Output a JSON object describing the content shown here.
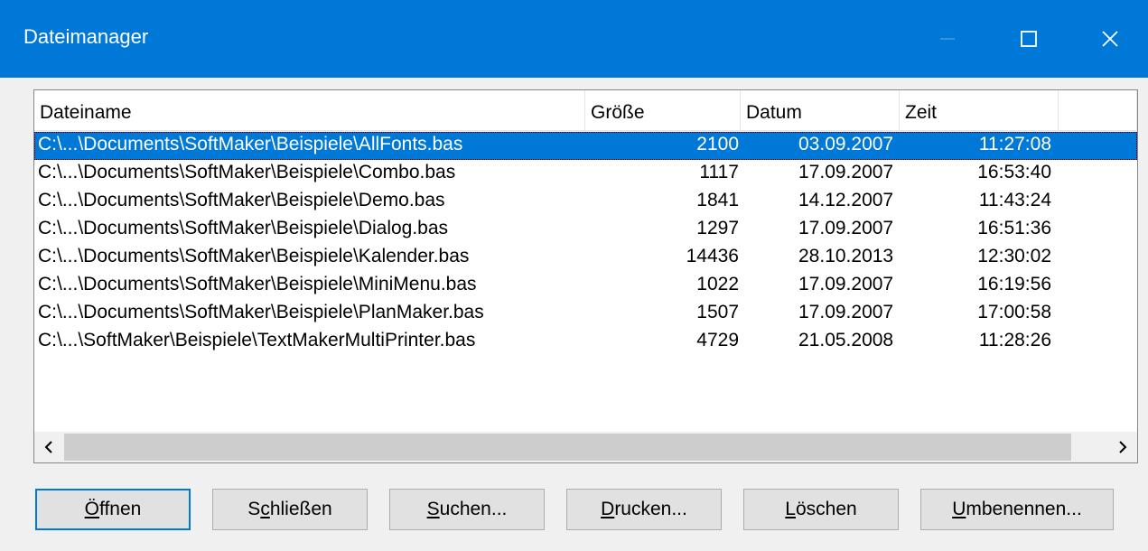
{
  "window": {
    "title": "Dateimanager"
  },
  "columns": {
    "name": "Dateiname",
    "size": "Größe",
    "date": "Datum",
    "time": "Zeit"
  },
  "files": [
    {
      "name": "C:\\...\\Documents\\SoftMaker\\Beispiele\\AllFonts.bas",
      "size": "2100",
      "date": "03.09.2007",
      "time": "11:27:08",
      "selected": true
    },
    {
      "name": "C:\\...\\Documents\\SoftMaker\\Beispiele\\Combo.bas",
      "size": "1117",
      "date": "17.09.2007",
      "time": "16:53:40"
    },
    {
      "name": "C:\\...\\Documents\\SoftMaker\\Beispiele\\Demo.bas",
      "size": "1841",
      "date": "14.12.2007",
      "time": "11:43:24"
    },
    {
      "name": "C:\\...\\Documents\\SoftMaker\\Beispiele\\Dialog.bas",
      "size": "1297",
      "date": "17.09.2007",
      "time": "16:51:36"
    },
    {
      "name": "C:\\...\\Documents\\SoftMaker\\Beispiele\\Kalender.bas",
      "size": "14436",
      "date": "28.10.2013",
      "time": "12:30:02"
    },
    {
      "name": "C:\\...\\Documents\\SoftMaker\\Beispiele\\MiniMenu.bas",
      "size": "1022",
      "date": "17.09.2007",
      "time": "16:19:56"
    },
    {
      "name": "C:\\...\\Documents\\SoftMaker\\Beispiele\\PlanMaker.bas",
      "size": "1507",
      "date": "17.09.2007",
      "time": "17:00:58"
    },
    {
      "name": "C:\\...\\SoftMaker\\Beispiele\\TextMakerMultiPrinter.bas",
      "size": "4729",
      "date": "21.05.2008",
      "time": "11:28:26"
    }
  ],
  "buttons": {
    "open": {
      "pre": "",
      "key": "Ö",
      "post": "ffnen"
    },
    "close": {
      "pre": "S",
      "key": "c",
      "post": "hließen"
    },
    "search": {
      "pre": "",
      "key": "S",
      "post": "uchen..."
    },
    "print": {
      "pre": "",
      "key": "D",
      "post": "rucken..."
    },
    "delete": {
      "pre": "",
      "key": "L",
      "post": "öschen"
    },
    "rename": {
      "pre": "",
      "key": "U",
      "post": "mbenennen..."
    }
  },
  "colors": {
    "titlebar": "#0078d7",
    "selection": "#0078d7",
    "face": "#f0f0f0"
  },
  "icons": [
    "minimize-icon",
    "maximize-icon",
    "close-icon",
    "chevron-left-icon",
    "chevron-right-icon"
  ]
}
